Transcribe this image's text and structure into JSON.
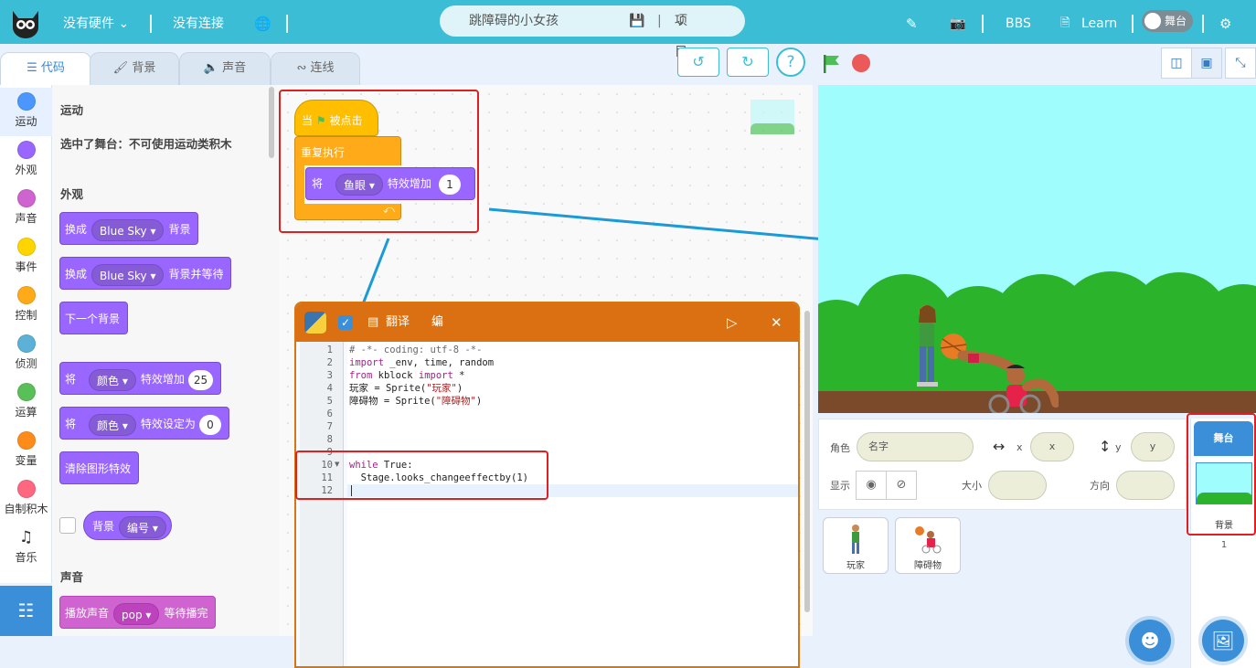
{
  "topbar": {
    "hardware": "没有硬件",
    "connection": "没有连接",
    "project_title": "跳障碍的小女孩",
    "project_menu": "项目",
    "bbs": "BBS",
    "learn": "Learn",
    "stage_toggle": "舞台",
    "bg_color": "#3bbdd6"
  },
  "tabs": [
    {
      "label": "代码",
      "icon": "code-icon"
    },
    {
      "label": "背景",
      "icon": "brush-icon"
    },
    {
      "label": "声音",
      "icon": "speaker-icon"
    },
    {
      "label": "连线",
      "icon": "wire-icon"
    }
  ],
  "categories": [
    {
      "label": "运动",
      "color": "#4c97ff"
    },
    {
      "label": "外观",
      "color": "#9966ff"
    },
    {
      "label": "声音",
      "color": "#cf63cf"
    },
    {
      "label": "事件",
      "color": "#ffd500"
    },
    {
      "label": "控制",
      "color": "#ffab19"
    },
    {
      "label": "侦测",
      "color": "#5cb1d6"
    },
    {
      "label": "运算",
      "color": "#59c059"
    },
    {
      "label": "变量",
      "color": "#ff8c1a"
    },
    {
      "label": "自制积木",
      "color": "#ff6680"
    },
    {
      "label": "音乐",
      "icon": "music-icon"
    }
  ],
  "palette": {
    "motion_heading": "运动",
    "motion_note": "选中了舞台：不可使用运动类积木",
    "looks_heading": "外观",
    "block1_pre": "换成",
    "block1_drop": "Blue Sky",
    "block1_post": "背景",
    "block2_pre": "换成",
    "block2_drop": "Blue Sky",
    "block2_post": "背景并等待",
    "block3": "下一个背景",
    "block4_pre": "将",
    "block4_drop": "颜色",
    "block4_post": "特效增加",
    "block4_val": "25",
    "block5_pre": "将",
    "block5_drop": "颜色",
    "block5_post": "特效设定为",
    "block5_val": "0",
    "block6": "清除图形特效",
    "block7_pre": "背景",
    "block7_drop": "编号",
    "sound_heading": "声音",
    "block8_pre": "播放声音",
    "block8_drop": "pop",
    "block8_post": "等待播完"
  },
  "script": {
    "hat_pre": "当",
    "hat_post": "被点击",
    "forever": "重复执行",
    "effect_pre": "将",
    "effect_drop": "鱼眼",
    "effect_post": "特效增加",
    "effect_val": "1"
  },
  "python": {
    "translate": "翻译",
    "edit": "编辑",
    "line_numbers": [
      "1",
      "2",
      "3",
      "4",
      "5",
      "6",
      "7",
      "8",
      "9",
      "10",
      "11",
      "12"
    ],
    "line1": "# -*- coding: utf-8 -*-",
    "line2_kw": "import",
    "line2_rest": " _env, time, random",
    "line3_kw1": "from",
    "line3_mid": " kblock ",
    "line3_kw2": "import",
    "line3_rest": " *",
    "line4_pre": "玩家 = Sprite(",
    "line4_str": "\"玩家\"",
    "line4_post": ")",
    "line5_pre": "障碍物 = Sprite(",
    "line5_str": "\"障碍物\"",
    "line5_post": ")",
    "line10_kw": "while",
    "line10_rest": " True:",
    "line11": "  Stage.looks_changeeffectby(1)"
  },
  "sprite_info": {
    "sprite_label": "角色",
    "name_placeholder": "名字",
    "x_label": "x",
    "x_value": "x",
    "y_label": "y",
    "y_value": "y",
    "show_label": "显示",
    "size_label": "大小",
    "direction_label": "方向"
  },
  "sprites": [
    {
      "name": "玩家"
    },
    {
      "name": "障碍物"
    }
  ],
  "stage_panel": {
    "header": "舞台",
    "backdrop_label": "背景",
    "backdrop_count": "1"
  }
}
